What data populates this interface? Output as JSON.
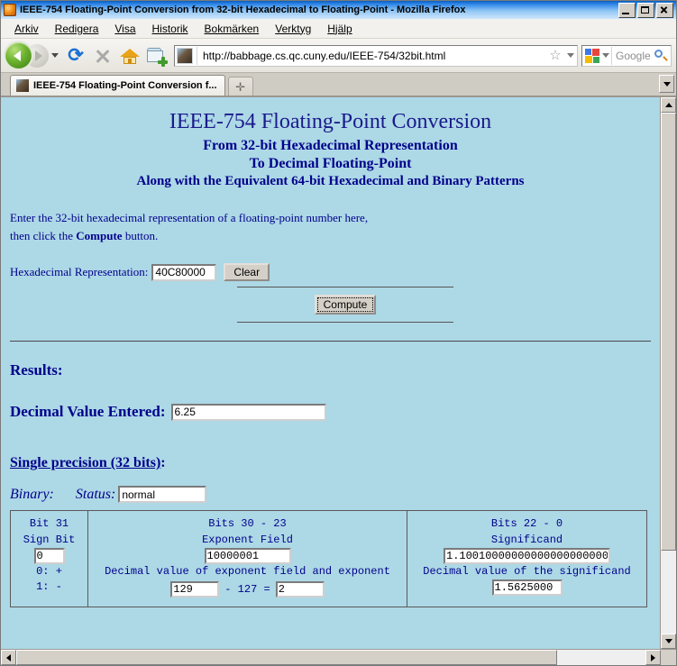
{
  "window": {
    "title": "IEEE-754 Floating-Point Conversion from 32-bit Hexadecimal to Floating-Point - Mozilla Firefox",
    "icon": "firefox-icon",
    "minimize_label": "Minimize",
    "maximize_label": "Maximize",
    "close_label": "Close"
  },
  "menubar": [
    {
      "label": "Arkiv",
      "accel": "A"
    },
    {
      "label": "Redigera",
      "accel": "R"
    },
    {
      "label": "Visa",
      "accel": "s"
    },
    {
      "label": "Historik",
      "accel": "o"
    },
    {
      "label": "Bokmärken",
      "accel": "B"
    },
    {
      "label": "Verktyg",
      "accel": "V"
    },
    {
      "label": "Hjälp",
      "accel": "H"
    }
  ],
  "toolbar": {
    "back_label": "Back",
    "forward_label": "Forward",
    "history_dropdown_label": "Recent pages",
    "reload_label": "Reload",
    "reload_glyph": "⟳",
    "stop_label": "Stop",
    "home_label": "Home",
    "newfolder_label": "Subscribe",
    "url": "http://babbage.cs.qc.cuny.edu/IEEE-754/32bit.html",
    "url_placeholder": "Search or enter address",
    "bookmark_star_glyph": "☆",
    "search_engine": "Google",
    "search_placeholder": "Google",
    "search_value": ""
  },
  "tabs": {
    "items": [
      {
        "label": "IEEE-754 Floating-Point Conversion f...",
        "active": true
      }
    ],
    "new_tab_glyph": "✛",
    "new_tab_label": "New Tab",
    "list_all_label": "List all tabs"
  },
  "page": {
    "title": "IEEE-754 Floating-Point Conversion",
    "subtitle1": "From 32-bit Hexadecimal Representation",
    "subtitle2": "To Decimal Floating-Point",
    "subtitle3": "Along with the Equivalent 64-bit Hexadecimal and Binary Patterns",
    "intro_line1": "Enter the 32-bit hexadecimal representation of a floating-point number here,",
    "intro_line2_pre": "then click the ",
    "intro_line2_bold": "Compute",
    "intro_line2_post": " button.",
    "hex_label": "Hexadecimal Representation:",
    "hex_value": "40C80000",
    "hex_placeholder": "",
    "clear_label": "Clear",
    "compute_label": "Compute",
    "results_label": "Results:",
    "decimal_label": "Decimal Value Entered:",
    "decimal_value": "6.25",
    "single_precision_heading": "Single precision (32 bits)",
    "single_precision_colon": ":",
    "binary_label": "Binary:",
    "status_label": "Status:",
    "status_value": "normal",
    "bits": {
      "sign": {
        "bits_label": "Bit 31",
        "field_label": "Sign Bit",
        "value": "0",
        "legend_plus": "0: +",
        "legend_minus": "1: -"
      },
      "exponent": {
        "bits_label": "Bits 30 - 23",
        "field_label": "Exponent Field",
        "binary_value": "10000001",
        "decimal_label": "Decimal value of exponent field and exponent",
        "decimal_value": "129",
        "bias_text": "- 127 =",
        "exponent_value": "2"
      },
      "significand": {
        "bits_label": "Bits 22 - 0",
        "field_label": "Significand",
        "binary_value": "1.10010000000000000000000",
        "decimal_label": "Decimal value of the significand",
        "decimal_value": "1.5625000"
      }
    }
  },
  "colors": {
    "page_background": "#add8e6",
    "page_text": "#00008b",
    "chrome_background": "#d4d0c8",
    "titlebar_start": "#0a5fc0",
    "accent_back_button": "#6cb32e"
  },
  "scrollbars": {
    "up_label": "Scroll up",
    "down_label": "Scroll down",
    "left_label": "Scroll left",
    "right_label": "Scroll right"
  }
}
